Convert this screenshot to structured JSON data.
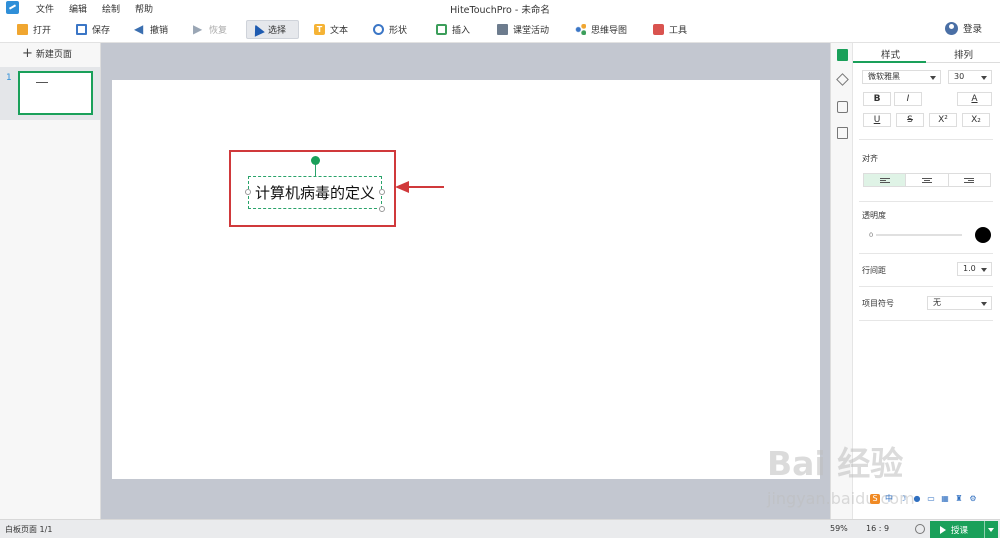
{
  "window": {
    "title": "HiteTouchPro - 未命名"
  },
  "menu": [
    "文件",
    "编辑",
    "绘制",
    "帮助"
  ],
  "toolbar": {
    "open": "打开",
    "save": "保存",
    "undo": "撤销",
    "redo": "恢复",
    "select": "选择",
    "text": "文本",
    "shape": "形状",
    "insert": "插入",
    "activity": "课堂活动",
    "mindmap": "思维导图",
    "tools": "工具",
    "login": "登录"
  },
  "left_panel": {
    "new_page": "新建页面",
    "slide_number": "1"
  },
  "canvas": {
    "textbox_text": "计算机病毒的定义"
  },
  "props": {
    "tab_style": "样式",
    "tab_arrange": "排列",
    "font_family": "微软雅黑",
    "font_size": "30",
    "bold": "B",
    "italic": "I",
    "font_color_label": "A",
    "underline": "U",
    "strike": "S",
    "superscript": "X²",
    "subscript": "X₂",
    "align_label": "对齐",
    "opacity_label": "透明度",
    "opacity_value": "0",
    "line_spacing_label": "行间距",
    "line_spacing_value": "1.0",
    "bullet_label": "项目符号",
    "bullet_value": "无",
    "text_color": "#000000"
  },
  "statusbar": {
    "page_info": "白板页面 1/1",
    "zoom": "59%",
    "ratio": "16 : 9",
    "start_label": "授课"
  },
  "watermark": {
    "line1": "Bai 经验",
    "line2": "jingyan.baidu.com"
  },
  "ime": [
    "中"
  ],
  "colors": {
    "accent": "#1aa05a",
    "annotation": "#d0393b"
  }
}
